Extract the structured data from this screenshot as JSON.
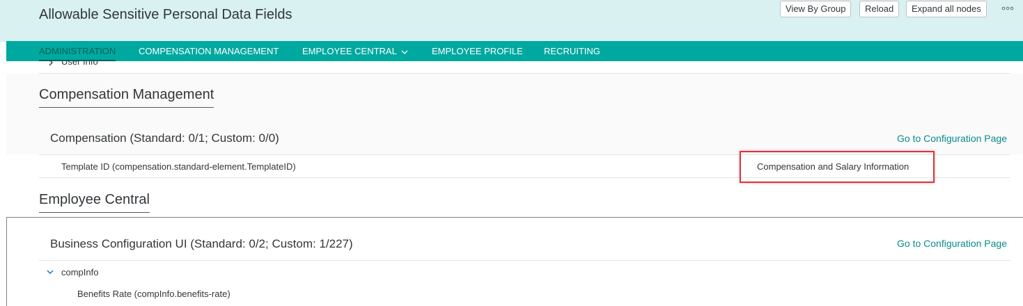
{
  "header": {
    "title": "Allowable Sensitive Personal Data Fields",
    "buttons": {
      "view_by_group": "View By Group",
      "reload": "Reload",
      "expand_all": "Expand all nodes"
    },
    "overflow_icon": "overflow-dots-icon"
  },
  "tabs": [
    {
      "label": "ADMINISTRATION",
      "active": true
    },
    {
      "label": "COMPENSATION MANAGEMENT",
      "active": false
    },
    {
      "label": "EMPLOYEE CENTRAL",
      "active": false,
      "icon": "chevron-down-icon"
    },
    {
      "label": "EMPLOYEE PROFILE",
      "active": false
    },
    {
      "label": "RECRUITING",
      "active": false
    }
  ],
  "peek_row": {
    "label": "User Info",
    "icon": "chevron-right-icon"
  },
  "sections": [
    {
      "title": "Compensation Management",
      "groups": [
        {
          "title": "Compensation (Standard: 0/1; Custom: 0/0)",
          "link": "Go to Configuration Page",
          "rows": [
            {
              "label": "Template ID (compensation.standard-element.TemplateID)",
              "value": "Compensation and Salary Information"
            }
          ]
        }
      ]
    },
    {
      "title": "Employee Central",
      "groups": [
        {
          "title": "Business Configuration UI (Standard: 0/2; Custom: 1/227)",
          "link": "Go to Configuration Page",
          "node": {
            "label": "compInfo",
            "expanded": true,
            "icon": "chevron-down-icon"
          },
          "rows": [
            {
              "label": "Benefits Rate (compInfo.benefits-rate)"
            }
          ]
        }
      ]
    }
  ],
  "colors": {
    "header_bg": "#d9f1f1",
    "tabbar_bg": "#00a9a0",
    "link": "#0a8c8c",
    "highlight": "#d9363e"
  }
}
